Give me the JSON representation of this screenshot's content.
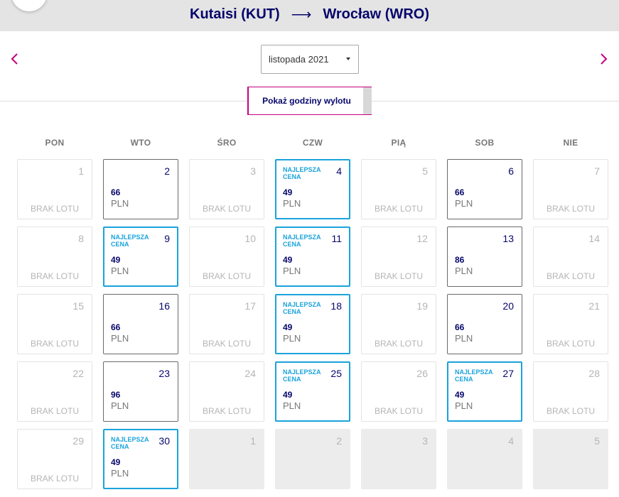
{
  "header": {
    "origin": "Kutaisi (KUT)",
    "arrow": "⟶",
    "destination": "Wrocław (WRO)"
  },
  "controls": {
    "month": "listopada 2021",
    "show_times_label": "Pokaż godziny wylotu"
  },
  "colors": {
    "accent": "#c6007e",
    "navy": "#06066b",
    "best": "#1aa3dc"
  },
  "weekdays": [
    "PON",
    "WTO",
    "ŚRO",
    "CZW",
    "PIĄ",
    "SOB",
    "NIE"
  ],
  "labels": {
    "no_flight": "BRAK LOTU",
    "best_price": "NAJLEPSZA CENA",
    "currency": "PLN"
  },
  "calendar": [
    [
      {
        "day": "1",
        "type": "empty"
      },
      {
        "day": "2",
        "type": "price",
        "price": "66"
      },
      {
        "day": "3",
        "type": "empty"
      },
      {
        "day": "4",
        "type": "best",
        "price": "49"
      },
      {
        "day": "5",
        "type": "empty"
      },
      {
        "day": "6",
        "type": "price",
        "price": "66"
      },
      {
        "day": "7",
        "type": "empty"
      }
    ],
    [
      {
        "day": "8",
        "type": "empty"
      },
      {
        "day": "9",
        "type": "best",
        "price": "49"
      },
      {
        "day": "10",
        "type": "empty"
      },
      {
        "day": "11",
        "type": "best",
        "price": "49"
      },
      {
        "day": "12",
        "type": "empty"
      },
      {
        "day": "13",
        "type": "price",
        "price": "86"
      },
      {
        "day": "14",
        "type": "empty"
      }
    ],
    [
      {
        "day": "15",
        "type": "empty"
      },
      {
        "day": "16",
        "type": "price",
        "price": "66"
      },
      {
        "day": "17",
        "type": "empty"
      },
      {
        "day": "18",
        "type": "best",
        "price": "49"
      },
      {
        "day": "19",
        "type": "empty"
      },
      {
        "day": "20",
        "type": "price",
        "price": "66"
      },
      {
        "day": "21",
        "type": "empty"
      }
    ],
    [
      {
        "day": "22",
        "type": "empty"
      },
      {
        "day": "23",
        "type": "price",
        "price": "96"
      },
      {
        "day": "24",
        "type": "empty"
      },
      {
        "day": "25",
        "type": "best",
        "price": "49"
      },
      {
        "day": "26",
        "type": "empty"
      },
      {
        "day": "27",
        "type": "best",
        "price": "49"
      },
      {
        "day": "28",
        "type": "empty"
      }
    ],
    [
      {
        "day": "29",
        "type": "empty"
      },
      {
        "day": "30",
        "type": "best",
        "price": "49"
      },
      {
        "day": "1",
        "type": "other"
      },
      {
        "day": "2",
        "type": "other"
      },
      {
        "day": "3",
        "type": "other"
      },
      {
        "day": "4",
        "type": "other"
      },
      {
        "day": "5",
        "type": "other"
      }
    ]
  ]
}
